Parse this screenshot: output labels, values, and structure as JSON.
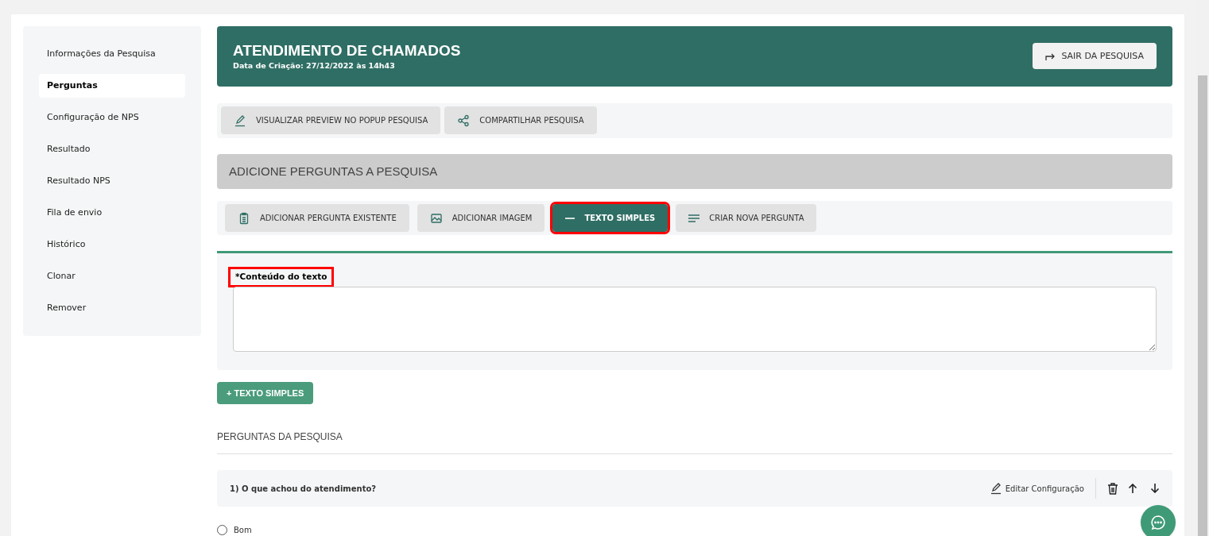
{
  "sidebar": {
    "items": [
      {
        "label": "Informações da Pesquisa",
        "selected": false
      },
      {
        "label": "Perguntas",
        "selected": true
      },
      {
        "label": "Configuração de NPS",
        "selected": false
      },
      {
        "label": "Resultado",
        "selected": false
      },
      {
        "label": "Resultado NPS",
        "selected": false
      },
      {
        "label": "Fila de envio",
        "selected": false
      },
      {
        "label": "Histórico",
        "selected": false
      },
      {
        "label": "Clonar",
        "selected": false
      },
      {
        "label": "Remover",
        "selected": false
      }
    ]
  },
  "header": {
    "title": "ATENDIMENTO DE CHAMADOS",
    "subtitle": "Data de Criação: 27/12/2022 às 14h43",
    "exit_button": "SAIR DA PESQUISA"
  },
  "actions": [
    {
      "kind": "pencil",
      "label": "VISUALIZAR PREVIEW NO POPUP PESQUISA"
    },
    {
      "kind": "share",
      "label": "COMPARTILHAR PESQUISA"
    }
  ],
  "section_title": "ADICIONE PERGUNTAS A PESQUISA",
  "tools": [
    {
      "kind": "clipboard",
      "label": "ADICIONAR PERGUNTA EXISTENTE",
      "selected": false,
      "highlighted": false
    },
    {
      "kind": "image",
      "label": "ADICIONAR IMAGEM",
      "selected": false,
      "highlighted": false
    },
    {
      "kind": "dash",
      "label": "TEXTO SIMPLES",
      "selected": true,
      "highlighted": true
    },
    {
      "kind": "lines",
      "label": "CRIAR NOVA PERGUNTA",
      "selected": false,
      "highlighted": false
    }
  ],
  "form": {
    "label": "*Conteúdo do texto",
    "label_highlighted": true,
    "submit": "+ TEXTO SIMPLES"
  },
  "questions_title": "PERGUNTAS DA PESQUISA",
  "questions": [
    {
      "title": "1) O que achou do atendimento?",
      "edit": "Editar Configuração",
      "options": [
        {
          "label": "Bom",
          "selected": false
        }
      ]
    }
  ]
}
